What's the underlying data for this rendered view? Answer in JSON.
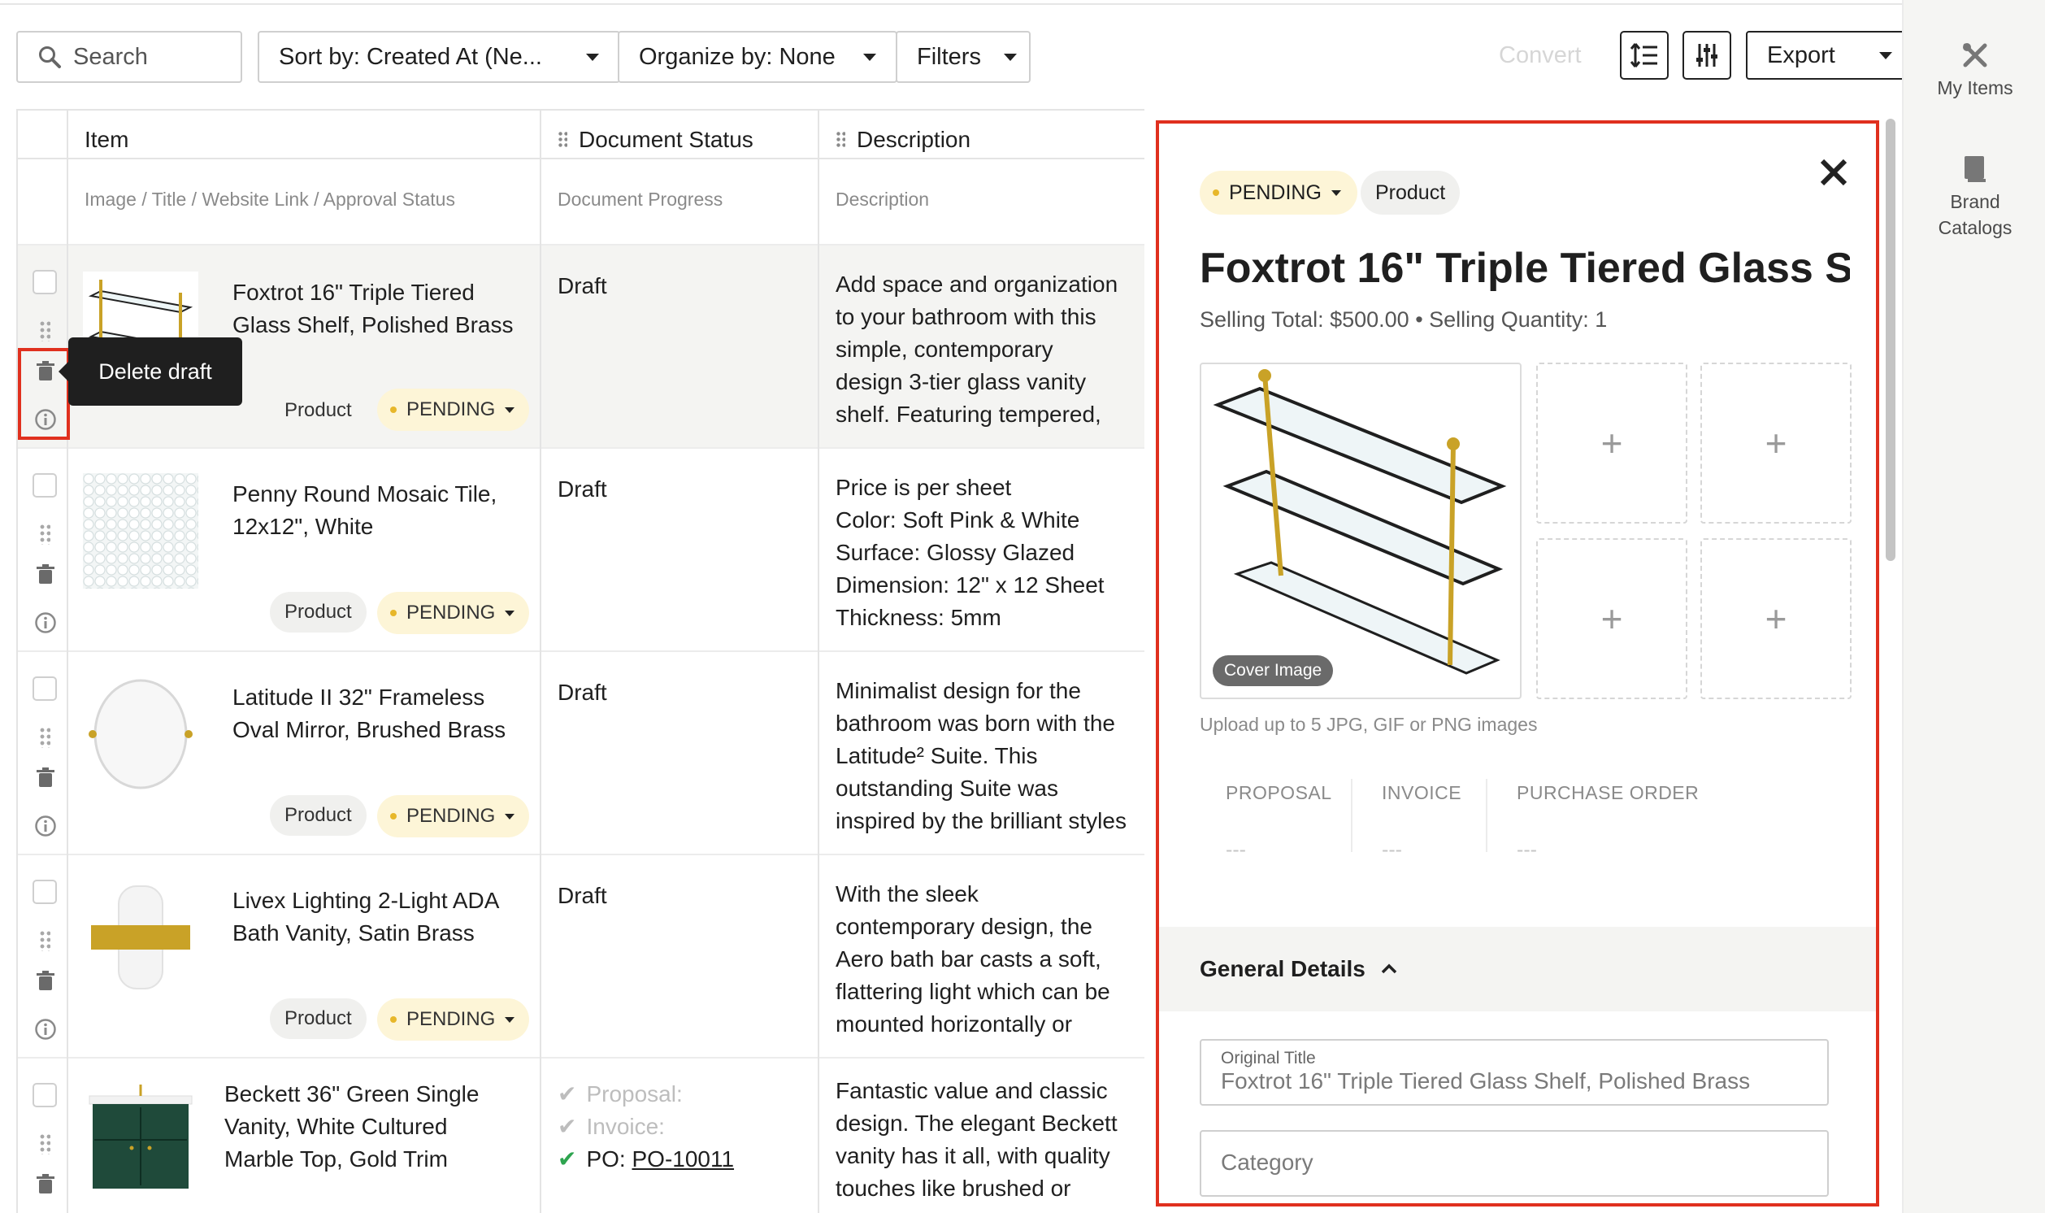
{
  "toolbar": {
    "search_placeholder": "Search",
    "sort_label": "Sort by: Created At (Ne...",
    "organize_label": "Organize by: None",
    "filters_label": "Filters",
    "convert_label": "Convert",
    "export_label": "Export"
  },
  "table": {
    "headers": [
      {
        "label": "Item",
        "sub": "Image / Title / Website Link / Approval Status"
      },
      {
        "label": "Document Status",
        "sub": "Document Progress"
      },
      {
        "label": "Description",
        "sub": "Description"
      }
    ],
    "rows": [
      {
        "title": "Foxtrot 16\" Triple Tiered Glass Shelf, Polished Brass",
        "type": "Product",
        "status": "PENDING",
        "doc_status": "Draft",
        "description": "Add space and organization\nto your bathroom with this\nsimple, contemporary\ndesign 3-tier glass vanity\nshelf. Featuring tempered,"
      },
      {
        "title": "Penny Round Mosaic Tile, 12x12\", White",
        "type": "Product",
        "status": "PENDING",
        "doc_status": "Draft",
        "description": "Price is per sheet\nColor: Soft Pink & White\nSurface: Glossy Glazed\nDimension: 12\" x 12 Sheet\nThickness: 5mm"
      },
      {
        "title": "Latitude II 32\" Frameless Oval Mirror, Brushed Brass",
        "type": "Product",
        "status": "PENDING",
        "doc_status": "Draft",
        "description": "Minimalist design for the\nbathroom was born with the\nLatitude² Suite. This\noutstanding Suite was\ninspired by the brilliant styles"
      },
      {
        "title": "Livex Lighting 2-Light ADA Bath Vanity, Satin Brass",
        "type": "Product",
        "status": "PENDING",
        "doc_status": "Draft",
        "description": "With the sleek\ncontemporary design, the\nAero bath bar casts a soft,\nflattering light which can be\nmounted horizontally or"
      },
      {
        "title": "Beckett 36\" Green Single Vanity, White Cultured Marble Top, Gold Trim",
        "progress": {
          "proposal": "Proposal:",
          "invoice": "Invoice:",
          "po_label": "PO:",
          "po_value": "PO-10011"
        },
        "description": "Fantastic value and classic\ndesign. The elegant Beckett\nvanity has it all, with quality\ntouches like brushed or"
      }
    ]
  },
  "tooltip": "Delete draft",
  "panel": {
    "status": "PENDING",
    "type": "Product",
    "title": "Foxtrot 16\" Triple Tiered Glass S...",
    "subtitle": "Selling Total: $500.00 • Selling Quantity: 1",
    "cover_label": "Cover Image",
    "upload_hint": "Upload up to 5 JPG, GIF or PNG images",
    "docs": [
      {
        "label": "PROPOSAL",
        "value": "---"
      },
      {
        "label": "INVOICE",
        "value": "---"
      },
      {
        "label": "PURCHASE ORDER",
        "value": "---"
      }
    ],
    "general_details": "General Details",
    "original_title_label": "Original Title",
    "original_title_value": "Foxtrot 16\" Triple Tiered Glass Shelf, Polished Brass",
    "category_placeholder": "Category"
  },
  "sidebar": {
    "items": [
      {
        "label": "My Items",
        "icon": "tools-icon"
      },
      {
        "label": "Brand Catalogs",
        "icon": "book-icon"
      }
    ]
  },
  "colors": {
    "highlight": "#e0301e",
    "pending_bg": "#fdf5d7",
    "pending_dot": "#e7b72a",
    "check": "#2ea44f"
  }
}
